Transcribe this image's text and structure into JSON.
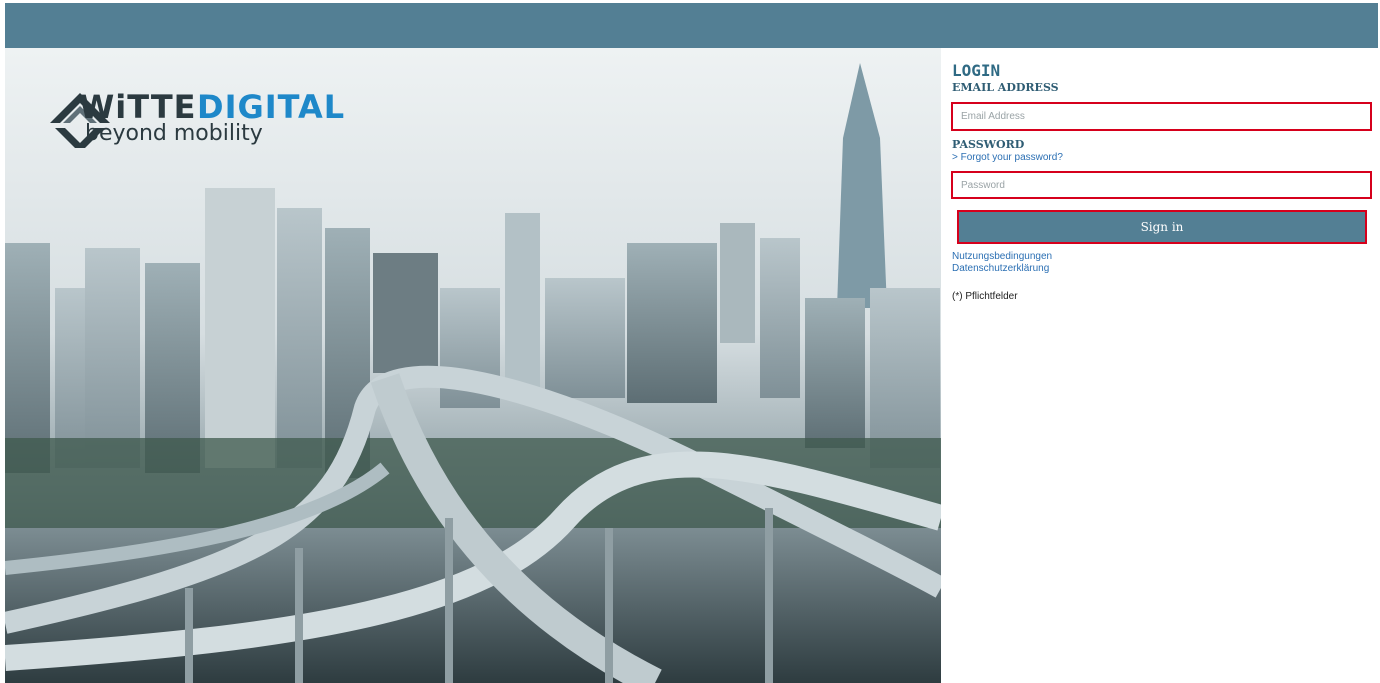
{
  "brand": {
    "name_part1": "WiTTE",
    "name_part2": "DIGITAL",
    "tagline": "beyond mobility",
    "dark_color": "#2b3a40",
    "accent_color": "#1e88c9"
  },
  "header": {
    "bar_color": "#537f94"
  },
  "login": {
    "title": "LOGIN",
    "email_label": "EMAIL ADDRESS",
    "email_placeholder": "Email Address",
    "email_value": "",
    "password_label": "PASSWORD",
    "forgot_link": "> Forgot your password?",
    "password_placeholder": "Password",
    "password_value": "",
    "signin_label": "Sign in",
    "terms_link": "Nutzungsbedingungen",
    "privacy_link": "Datenschutzerklärung",
    "required_note": "(*) Pflichtfelder",
    "highlight_color": "#d6001c"
  },
  "hero": {
    "icon": "city-highway-image"
  }
}
